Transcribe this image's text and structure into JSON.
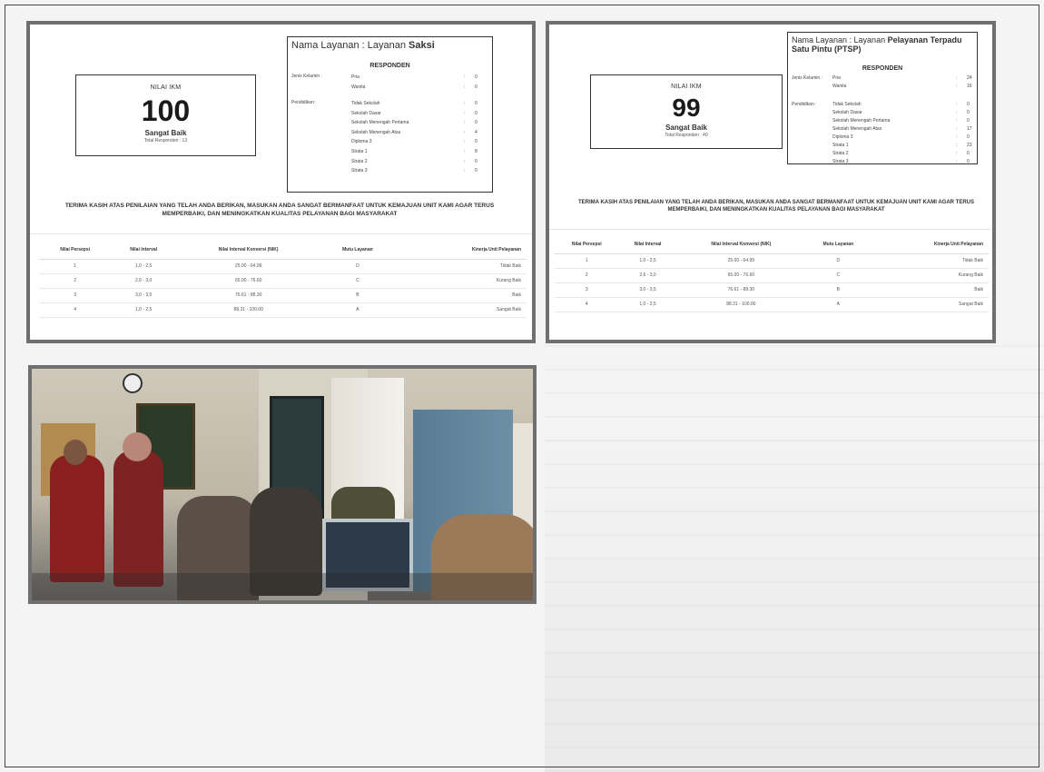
{
  "panels": [
    {
      "ikm": {
        "label": "NILAI IKM",
        "value": "100",
        "mutu": "Sangat Baik",
        "total": "Total Responden : 13"
      },
      "layanan_prefix": "Nama Layanan : Layanan",
      "layanan_name": "Saksi",
      "responden_title": "RESPONDEN",
      "jenis_kelamin_label": "Jenis Kelamin :",
      "pendidikan_label": "Pendidikan :",
      "gender": [
        {
          "name": "Pria",
          "sep": ":",
          "value": "0"
        },
        {
          "name": "Wanita",
          "sep": ":",
          "value": "0"
        }
      ],
      "education": [
        {
          "name": "Tidak Sekolah",
          "sep": ":",
          "value": "0"
        },
        {
          "name": "Sekolah Dasar",
          "sep": ":",
          "value": "0"
        },
        {
          "name": "Sekolah Menengah Pertama",
          "sep": ":",
          "value": "0"
        },
        {
          "name": "Sekolah Menengah Atas",
          "sep": ":",
          "value": "4"
        },
        {
          "name": "Diploma 3",
          "sep": ":",
          "value": "0"
        },
        {
          "name": "Strata 1",
          "sep": ":",
          "value": "8"
        },
        {
          "name": "Strata 2",
          "sep": ":",
          "value": "0"
        },
        {
          "name": "Strata 3",
          "sep": ":",
          "value": "0"
        }
      ],
      "thanks_line1": "TERIMA KASIH ATAS PENILAIAN YANG TELAH ANDA BERIKAN, MASUKAN ANDA SANGAT BERMANFAAT UNTUK KEMAJUAN UNIT KAMI AGAR TERUS",
      "thanks_line2": "MEMPERBAIKI, DAN MENINGKATKAN KUALITAS PELAYANAN BAGI MASYARAKAT",
      "table": {
        "headers": [
          "Nilai Persepsi",
          "Nilai Interval",
          "Nilai Interval Konversi (NIK)",
          "Mutu Layanan",
          "Kinerja Unit Pelayanan"
        ],
        "rows": [
          [
            "1",
            "1,0 - 2,5",
            "25.00 - 64.99",
            "D",
            "Tidak Baik"
          ],
          [
            "2",
            "2,6 - 3,0",
            "65.00 - 76.60",
            "C",
            "Kurang Baik"
          ],
          [
            "3",
            "3,0 - 3,5",
            "76.61 - 88.30",
            "B",
            "Baik"
          ],
          [
            "4",
            "1,0 - 2,5",
            "88.31 - 100.00",
            "A",
            "Sangat Baik"
          ]
        ]
      }
    },
    {
      "ikm": {
        "label": "NILAI IKM",
        "value": "99",
        "mutu": "Sangat Baik",
        "total": "Total Responden : 40"
      },
      "layanan_prefix": "Nama Layanan : Layanan",
      "layanan_name": "Pelayanan Terpadu Satu Pintu (PTSP)",
      "responden_title": "RESPONDEN",
      "jenis_kelamin_label": "Jenis Kelamin :",
      "pendidikan_label": "Pendidikan :",
      "gender": [
        {
          "name": "Pria",
          "sep": ":",
          "value": "24"
        },
        {
          "name": "Wanita",
          "sep": ":",
          "value": "16"
        }
      ],
      "education": [
        {
          "name": "Tidak Sekolah",
          "sep": ":",
          "value": "0"
        },
        {
          "name": "Sekolah Dasar",
          "sep": ":",
          "value": "0"
        },
        {
          "name": "Sekolah Menengah Pertama",
          "sep": ":",
          "value": "0"
        },
        {
          "name": "Sekolah Menengah Atas",
          "sep": ":",
          "value": "17"
        },
        {
          "name": "Diploma 3",
          "sep": ":",
          "value": "0"
        },
        {
          "name": "Strata 1",
          "sep": ":",
          "value": "23"
        },
        {
          "name": "Strata 2",
          "sep": ":",
          "value": "0"
        },
        {
          "name": "Strata 3",
          "sep": ":",
          "value": "0"
        }
      ],
      "thanks_line1": "TERIMA KASIH ATAS PENILAIAN YANG TELAH ANDA BERIKAN, MASUKAN ANDA SANGAT BERMANFAAT UNTUK KEMAJUAN UNIT KAMI AGAR TERUS",
      "thanks_line2": "MEMPERBAIKI, DAN MENINGKATKAN KUALITAS PELAYANAN BAGI MASYARAKAT",
      "table": {
        "headers": [
          "Nilai Persepsi",
          "Nilai Interval",
          "Nilai Interval Konversi (NIK)",
          "Mutu Layanan",
          "Kinerja Unit Pelayanan"
        ],
        "rows": [
          [
            "1",
            "1,0 - 2,5",
            "25.00 - 64.99",
            "D",
            "Tidak Baik"
          ],
          [
            "2",
            "2,6 - 3,0",
            "65.00 - 76.60",
            "C",
            "Kurang Baik"
          ],
          [
            "3",
            "3,0 - 3,5",
            "76.61 - 88.30",
            "B",
            "Baik"
          ],
          [
            "4",
            "1,0 - 2,5",
            "88.31 - 100.00",
            "A",
            "Sangat Baik"
          ]
        ]
      }
    }
  ],
  "photo": {
    "colors": {
      "wall": "#c9c3b4",
      "cabinet": "#5f7f95",
      "jacket": "#8e2020",
      "monitor": "#2d3a4a"
    }
  }
}
